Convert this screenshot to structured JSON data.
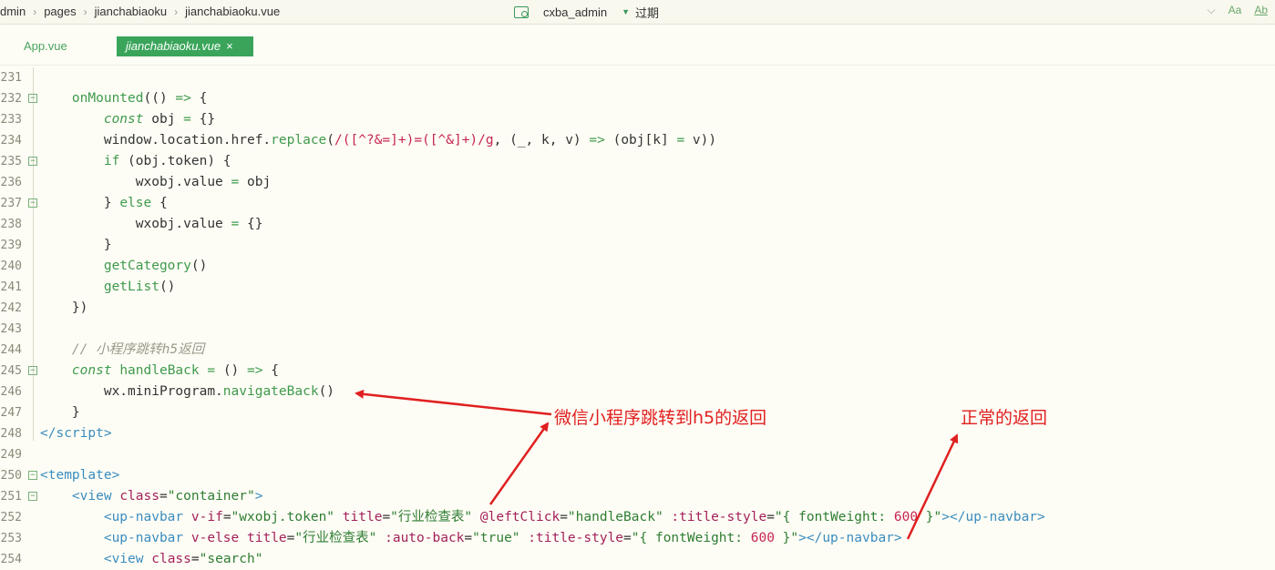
{
  "breadcrumb": [
    "dmin",
    "pages",
    "jianchabiaoku",
    "jianchabiaoku.vue"
  ],
  "project": {
    "name": "cxba_admin",
    "status": "过期"
  },
  "toolbar": {
    "match_case": "Aa",
    "word": "Ab"
  },
  "tabs": [
    {
      "label": "App.vue",
      "active": false
    },
    {
      "label": "jianchabiaoku.vue",
      "active": true,
      "close": "×"
    }
  ],
  "code_lines": [
    {
      "num": "231",
      "fold": false,
      "html": ""
    },
    {
      "num": "232",
      "fold": true,
      "html": "    <span class='f'>onMounted</span>(() <span class='k'>=></span> {"
    },
    {
      "num": "233",
      "fold": false,
      "html": "        <span class='ki'>const</span> obj <span class='k'>=</span> {}"
    },
    {
      "num": "234",
      "fold": false,
      "html": "        window.location.href.<span class='f'>replace</span>(<span class='re'>/([^?&=]+)=([^&]+)/g</span>, (_, k, v) <span class='k'>=></span> (obj[k] <span class='k'>=</span> v))"
    },
    {
      "num": "235",
      "fold": true,
      "html": "        <span class='k'>if</span> (obj.token) {"
    },
    {
      "num": "236",
      "fold": false,
      "html": "            wxobj.value <span class='k'>=</span> obj"
    },
    {
      "num": "237",
      "fold": true,
      "html": "        } <span class='k'>else</span> {"
    },
    {
      "num": "238",
      "fold": false,
      "html": "            wxobj.value <span class='k'>=</span> {}"
    },
    {
      "num": "239",
      "fold": false,
      "html": "        }"
    },
    {
      "num": "240",
      "fold": false,
      "html": "        <span class='f'>getCategory</span>()"
    },
    {
      "num": "241",
      "fold": false,
      "html": "        <span class='f'>getList</span>()"
    },
    {
      "num": "242",
      "fold": false,
      "html": "    })"
    },
    {
      "num": "243",
      "fold": false,
      "html": ""
    },
    {
      "num": "244",
      "fold": false,
      "html": "    <span class='c'>// 小程序跳转h5返回</span>"
    },
    {
      "num": "245",
      "fold": true,
      "html": "    <span class='ki'>const</span> <span class='f'>handleBack</span> <span class='k'>=</span> () <span class='k'>=></span> {"
    },
    {
      "num": "246",
      "fold": false,
      "html": "        wx.miniProgram.<span class='f'>navigateBack</span>()"
    },
    {
      "num": "247",
      "fold": false,
      "html": "    }"
    },
    {
      "num": "248",
      "fold": false,
      "html": "<span class='t'>&lt;/script&gt;</span>"
    },
    {
      "num": "249",
      "fold": false,
      "html": ""
    },
    {
      "num": "250",
      "fold": true,
      "html": "<span class='t'>&lt;template&gt;</span>"
    },
    {
      "num": "251",
      "fold": true,
      "html": "    <span class='t'>&lt;view</span> <span class='a'>class</span>=<span class='s'>\"container\"</span><span class='t'>&gt;</span>"
    },
    {
      "num": "252",
      "fold": false,
      "html": "        <span class='t'>&lt;up-navbar</span> <span class='a'>v-if</span>=<span class='s'>\"wxobj.token\"</span> <span class='a'>title</span>=<span class='s'>\"行业检查表\"</span> <span class='a'>@leftClick</span>=<span class='s'>\"handleBack\"</span> <span class='a'>:title-style</span>=<span class='s'>\"{ fontWeight: <span class='n'>600</span> }\"</span><span class='t'>&gt;&lt;/up-navbar&gt;</span>"
    },
    {
      "num": "253",
      "fold": false,
      "html": "        <span class='t'>&lt;up-navbar</span> <span class='a'>v-else</span> <span class='a'>title</span>=<span class='s'>\"行业检查表\"</span> <span class='a'>:auto-back</span>=<span class='s'>\"true\"</span> <span class='a'>:title-style</span>=<span class='s'>\"{ fontWeight: <span class='n'>600</span> }\"</span><span class='t'>&gt;&lt;/up-navbar&gt;</span>"
    },
    {
      "num": "254",
      "fold": false,
      "html": "        <span class='t'>&lt;view</span> <span class='a'>class</span>=<span class='s'>\"search\"</span>"
    }
  ],
  "annotations": {
    "wechat_back": "微信小程序跳转到h5的返回",
    "normal_back": "正常的返回"
  },
  "colors": {
    "accent": "#3aa55a",
    "annotation": "#e02020"
  }
}
